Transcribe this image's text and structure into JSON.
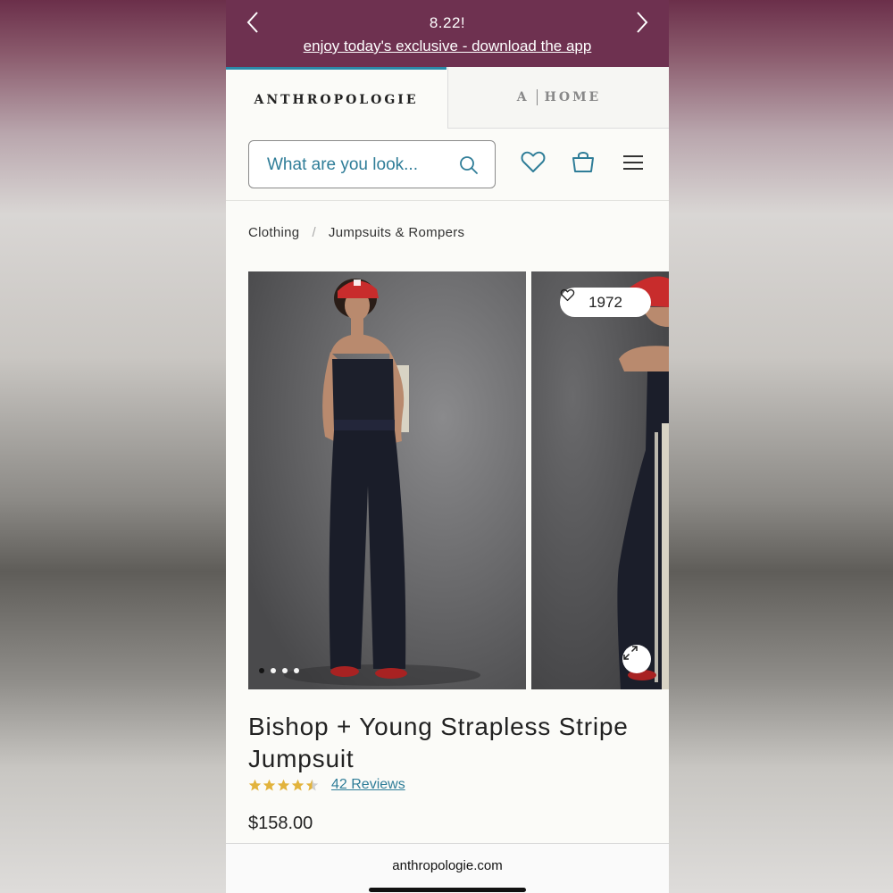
{
  "banner": {
    "title": "8.22!",
    "link_text": "enjoy today's exclusive - download the app",
    "background": "#6e3150"
  },
  "brand_tabs": {
    "primary": "ANTHROPOLOGIE",
    "secondary_left": "A",
    "secondary_right": "HOME"
  },
  "search": {
    "placeholder": "What are you look..."
  },
  "header_icons": [
    "heart-icon",
    "shopping-bag-icon",
    "hamburger-menu-icon"
  ],
  "breadcrumb": {
    "items": [
      "Clothing",
      "Jumpsuits & Rompers"
    ],
    "separator": "/"
  },
  "gallery": {
    "favorites_count": "1972",
    "image_count": 4,
    "active_image_index": 0
  },
  "product": {
    "title": "Bishop + Young Strapless Stripe Jumpsuit",
    "rating": 4.5,
    "reviews_label": "42 Reviews",
    "price": "$158.00",
    "accent_color": "#2f7d98",
    "star_color": "#e2b33c"
  },
  "browser": {
    "url": "anthropologie.com"
  }
}
